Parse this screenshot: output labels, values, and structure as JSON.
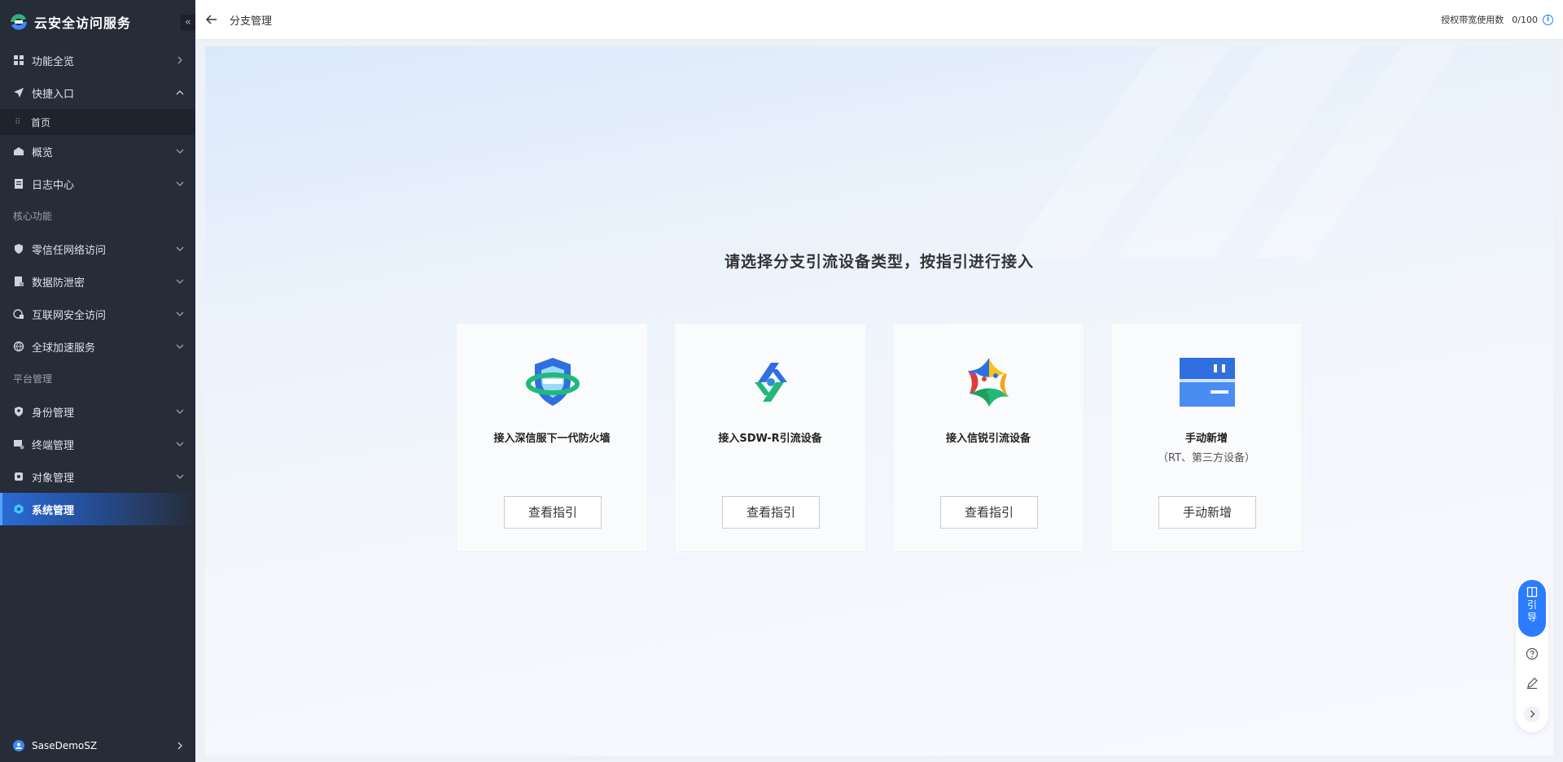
{
  "app": {
    "name": "云安全访问服务",
    "collapse_label": "«"
  },
  "sidebar": {
    "items": [
      {
        "label": "功能全览"
      },
      {
        "label": "快捷入口"
      },
      {
        "label": "首页"
      },
      {
        "label": "概览"
      },
      {
        "label": "日志中心"
      },
      {
        "label": "零信任网络访问"
      },
      {
        "label": "数据防泄密"
      },
      {
        "label": "互联网安全访问"
      },
      {
        "label": "全球加速服务"
      },
      {
        "label": "身份管理"
      },
      {
        "label": "终端管理"
      },
      {
        "label": "对象管理"
      },
      {
        "label": "系统管理"
      }
    ],
    "sections": {
      "core": "核心功能",
      "platform": "平台管理"
    },
    "user": "SaseDemoSZ"
  },
  "header": {
    "title": "分支管理",
    "quota_label": "授权带宽使用数",
    "quota_value": "0/100"
  },
  "main": {
    "title": "请选择分支引流设备类型，按指引进行接入",
    "cards": [
      {
        "title": "接入深信服下一代防火墙",
        "subtitle": "",
        "button": "查看指引"
      },
      {
        "title": "接入SDW-R引流设备",
        "subtitle": "",
        "button": "查看指引"
      },
      {
        "title": "接入信锐引流设备",
        "subtitle": "",
        "button": "查看指引"
      },
      {
        "title": "手动新增",
        "subtitle": "（RT、第三方设备）",
        "button": "手动新增"
      }
    ]
  },
  "float_tools": {
    "guide": "引导"
  },
  "colors": {
    "sidebar_bg": "#262c38",
    "accent": "#2b7cff",
    "active_nav": "#2a6bd6"
  }
}
